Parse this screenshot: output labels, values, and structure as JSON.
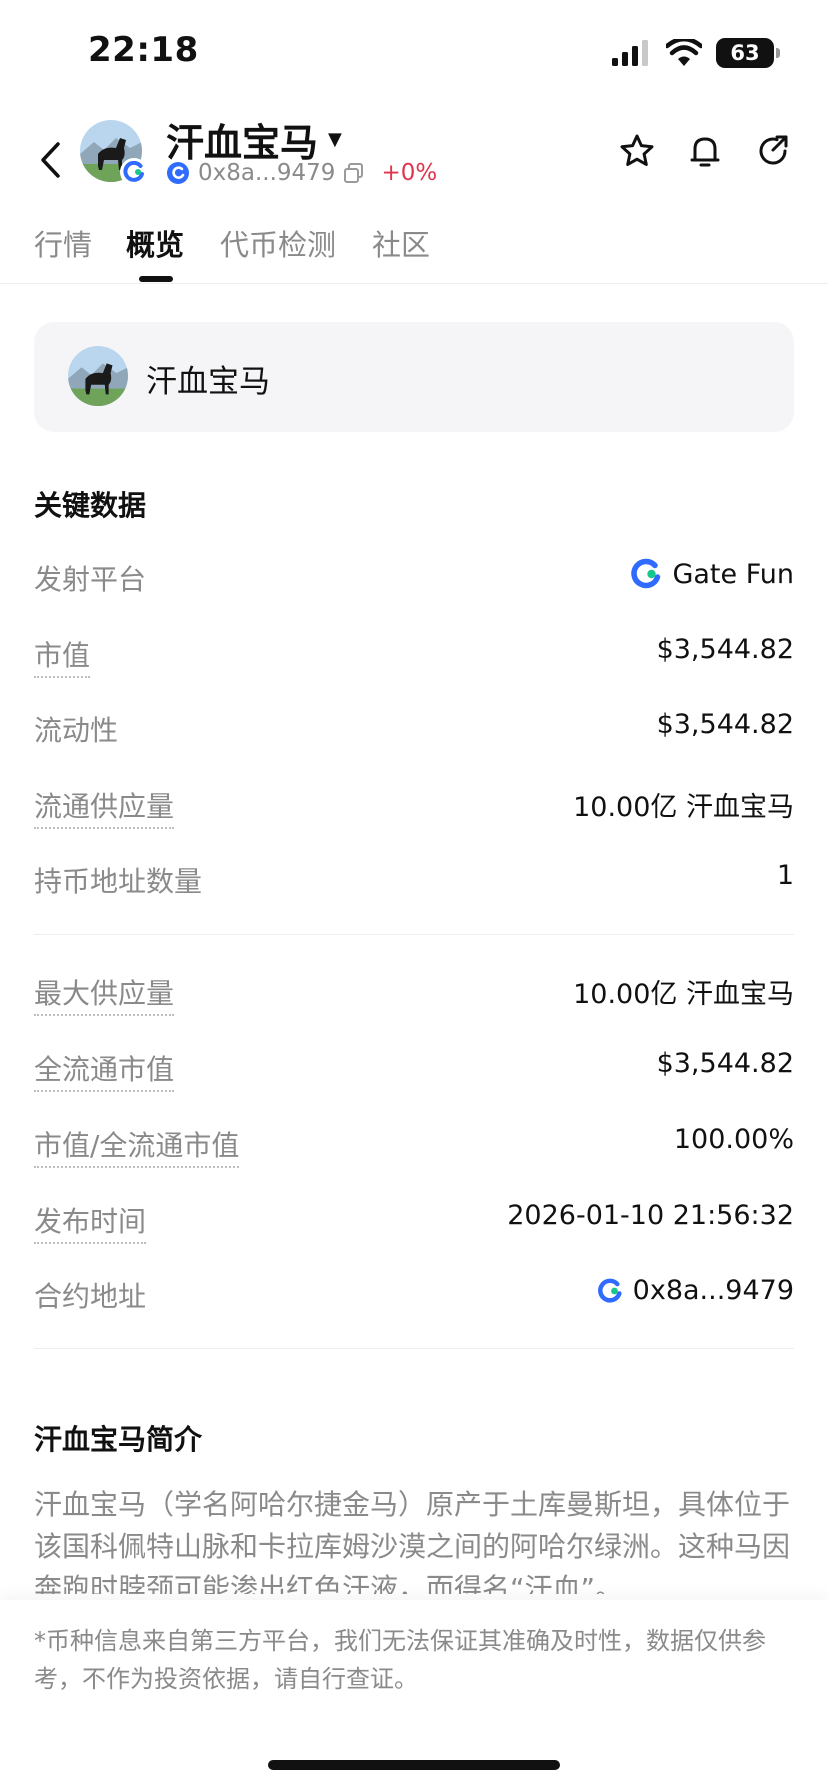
{
  "status_bar": {
    "time": "22:18",
    "battery": "63"
  },
  "header": {
    "title": "汗血宝马",
    "address": "0x8a...9479",
    "change": "+0%"
  },
  "tabs": [
    {
      "label": "行情"
    },
    {
      "label": "概览"
    },
    {
      "label": "代币检测"
    },
    {
      "label": "社区"
    }
  ],
  "token_card": {
    "name": "汗血宝马"
  },
  "key_data": {
    "title": "关键数据",
    "rows": [
      {
        "label": "发射平台",
        "value": "Gate Fun"
      },
      {
        "label": "市值",
        "value": "$3,544.82"
      },
      {
        "label": "流动性",
        "value": "$3,544.82"
      },
      {
        "label": "流通供应量",
        "value": "10.00亿 汗血宝马"
      },
      {
        "label": "持币地址数量",
        "value": "1"
      },
      {
        "label": "最大供应量",
        "value": "10.00亿 汗血宝马"
      },
      {
        "label": "全流通市值",
        "value": "$3,544.82"
      },
      {
        "label": "市值/全流通市值",
        "value": "100.00%"
      },
      {
        "label": "发布时间",
        "value": "2026-01-10 21:56:32"
      },
      {
        "label": "合约地址",
        "value": "0x8a...9479"
      }
    ]
  },
  "intro": {
    "title": "汗血宝马简介",
    "text": "汗血宝马（学名阿哈尔捷金马）原产于土库曼斯坦，具体位于该国科佩特山脉和卡拉库姆沙漠之间的阿哈尔绿洲。这种马因奔跑时脖颈可能渗出红色汗液，而得名“汗血”。"
  },
  "disclaimer": "*币种信息来自第三方平台，我们无法保证其准确及时性，数据仅供参考，不作为投资依据，请自行查证。",
  "colors": {
    "accent_red": "#e0354f",
    "gate_blue": "#2f6bff",
    "gate_green": "#17c88a"
  }
}
